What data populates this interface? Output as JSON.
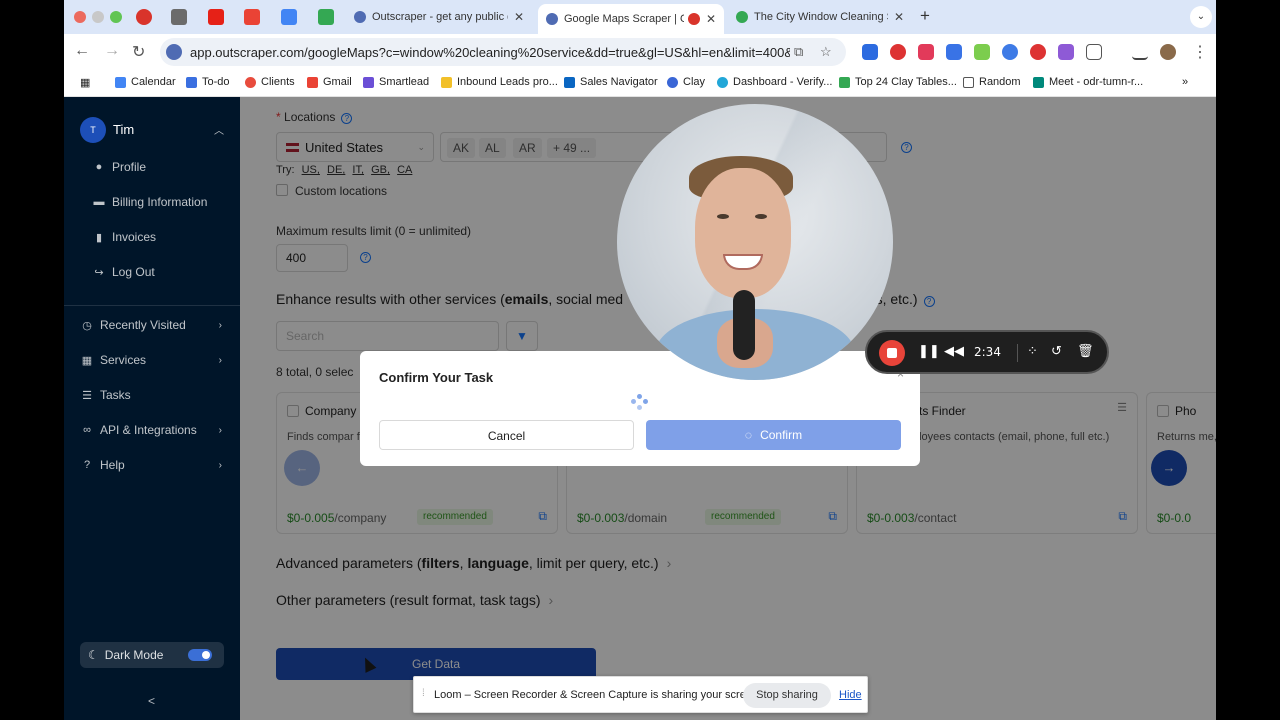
{
  "browser": {
    "tabs": [
      {
        "title": "Outscraper - get any public d"
      },
      {
        "title": "Google Maps Scraper | Ou"
      },
      {
        "title": "The City Window Cleaning Sp"
      }
    ],
    "new_tab": "+",
    "url": "app.outscraper.com/googleMaps?c=window%20cleaning%20service&dd=true&gl=US&hl=en&limit=400&tab=...",
    "bookmarks": [
      "Calendar",
      "To-do",
      "Clients",
      "Gmail",
      "Smartlead",
      "Inbound Leads pro...",
      "Sales Navigator",
      "Clay",
      "Dashboard - Verify...",
      "Top 24 Clay Tables...",
      "Random",
      "Meet - odr-tumn-r..."
    ],
    "more_bookmarks": "»"
  },
  "sidebar": {
    "user_initial": "T",
    "user_name": "Tim",
    "sub_items": [
      "Profile",
      "Billing Information",
      "Invoices",
      "Log Out"
    ],
    "nav_items": [
      "Recently Visited",
      "Services",
      "Tasks",
      "API & Integrations",
      "Help"
    ],
    "dark_mode_label": "Dark Mode",
    "collapse": "<"
  },
  "form": {
    "locations_label": "Locations",
    "country": "United States",
    "state_tags": [
      "AK",
      "AL",
      "AR",
      "+ 49 ..."
    ],
    "try_label": "Try:",
    "try_links": [
      "US,",
      "DE,",
      "IT,",
      "GB,",
      "CA"
    ],
    "custom_locations": "Custom locations",
    "limit_label": "Maximum results limit (0 = unlimited)",
    "limit_value": "400",
    "enhance_prefix": "Enhance results with other services (",
    "enhance_bold": "emails",
    "enhance_mid": ", social med",
    "enhance_suffix": "ees, etc.)",
    "search_placeholder": "Search",
    "total_text": "8 total, 0 selec",
    "advanced_prefix": "Advanced parameters (",
    "advanced_bold1": "filters",
    "advanced_sep": ", ",
    "advanced_bold2": "language",
    "advanced_suffix": ", limit per query, etc.)",
    "other_params": "Other parameters (result format, task tags)",
    "get_data": "Get Data"
  },
  "cards": [
    {
      "title": "Company",
      "desc": "Finds compar founding year",
      "price": "$0-0.005",
      "unit": "/company",
      "badge": "recommended"
    },
    {
      "title": "",
      "desc": "",
      "price": "$0-0.003",
      "unit": "/domain",
      "badge": "recommended"
    },
    {
      "title": "cts Finder",
      "desc": "ployees contacts (email, phone, full etc.)",
      "price": "$0-0.003",
      "unit": "/contact",
      "badge": ""
    },
    {
      "title": "Pho",
      "desc": "Returns me,",
      "price": "$0-0.0",
      "unit": "",
      "badge": ""
    }
  ],
  "modal": {
    "title": "Confirm Your Task",
    "close": "×",
    "cancel": "Cancel",
    "confirm": "Confirm"
  },
  "loom": {
    "time": "2:34",
    "share_message": "Loom – Screen Recorder & Screen Capture is sharing your screen.",
    "stop_sharing": "Stop sharing",
    "hide": "Hide"
  },
  "colors": {
    "sidebar_bg": "#001529",
    "primary": "#1e4db7",
    "confirm_loading": "#7fa0e8",
    "record_red": "#e8443a",
    "recommended_green": "#3a9a2a"
  }
}
